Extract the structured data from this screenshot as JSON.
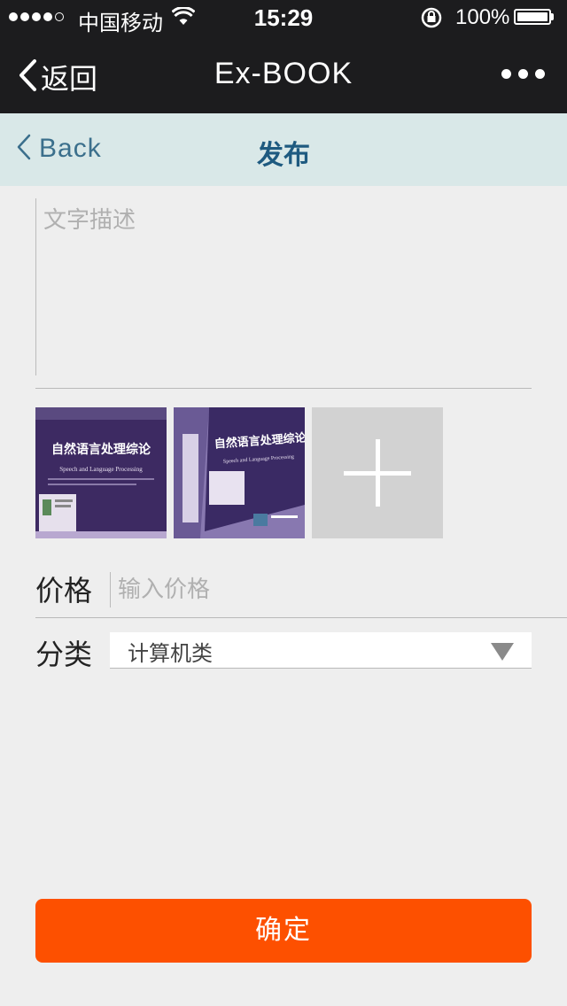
{
  "status_bar": {
    "carrier": "中国移动",
    "time": "15:29",
    "battery": "100%"
  },
  "nav": {
    "back_label": "返回",
    "title": "Ex-BOOK",
    "more_icon": "more-dots-icon"
  },
  "page_header": {
    "back_label": "Back",
    "title": "发布"
  },
  "form": {
    "description_placeholder": "文字描述",
    "description_value": "",
    "photos": [
      {
        "title": "自然语言处理综论",
        "subtitle": "Speech and Language Processing"
      },
      {
        "title": "自然语言处理综论",
        "subtitle": "Speech and Language Processing"
      }
    ],
    "add_photo_icon": "plus-icon",
    "price_label": "价格",
    "price_placeholder": "输入价格",
    "category_label": "分类",
    "category_value": "计算机类",
    "confirm_label": "确定"
  },
  "colors": {
    "nav_bg": "#1c1c1e",
    "header_bg": "#d9e8e8",
    "page_bg": "#eeeeee",
    "accent": "#fd5000",
    "title_blue": "#1e5a80"
  }
}
